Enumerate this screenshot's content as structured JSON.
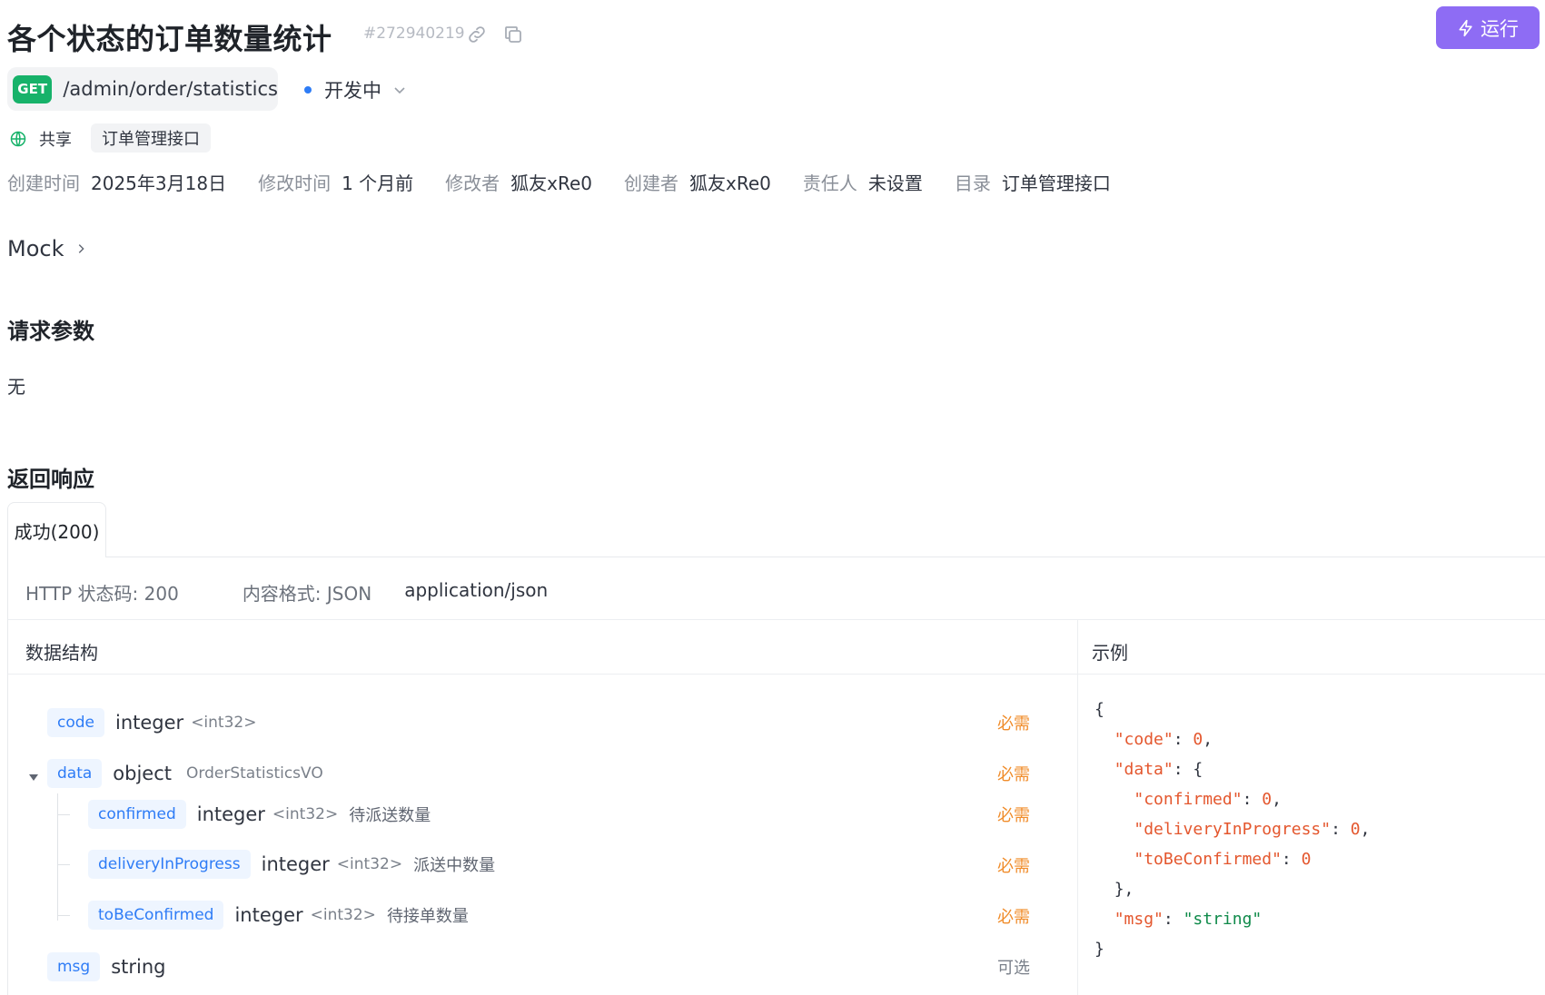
{
  "header": {
    "title": "各个状态的订单数量统计",
    "api_id": "#272940219",
    "run_label": "运行",
    "link_icon": "link-icon",
    "copy_icon": "copy-icon"
  },
  "endpoint": {
    "method": "GET",
    "path": "/admin/order/statistics",
    "status": "开发中",
    "status_color": "#2e7cf6",
    "method_color": "#17b26a"
  },
  "share": {
    "label": "共享",
    "tag": "订单管理接口"
  },
  "meta": [
    {
      "key": "创建时间",
      "value": "2025年3月18日"
    },
    {
      "key": "修改时间",
      "value": "1 个月前"
    },
    {
      "key": "修改者",
      "value": "狐友xRe0"
    },
    {
      "key": "创建者",
      "value": "狐友xRe0"
    },
    {
      "key": "责任人",
      "value": "未设置"
    },
    {
      "key": "目录",
      "value": "订单管理接口"
    }
  ],
  "mock_label": "Mock",
  "request": {
    "heading": "请求参数",
    "empty": "无"
  },
  "response": {
    "heading": "返回响应",
    "tab": "成功(200)",
    "http_status": "HTTP 状态码: 200",
    "content_type": "内容格式: JSON",
    "mime": "application/json",
    "schema_title": "数据结构",
    "example_title": "示例",
    "fields": [
      {
        "name": "code",
        "type": "integer",
        "format": "<int32>",
        "desc": "",
        "required": "必需"
      },
      {
        "name": "data",
        "type": "object",
        "format": "OrderStatisticsVO",
        "desc": "",
        "required": "必需"
      },
      {
        "name": "confirmed",
        "type": "integer",
        "format": "<int32>",
        "desc": "待派送数量",
        "required": "必需"
      },
      {
        "name": "deliveryInProgress",
        "type": "integer",
        "format": "<int32>",
        "desc": "派送中数量",
        "required": "必需"
      },
      {
        "name": "toBeConfirmed",
        "type": "integer",
        "format": "<int32>",
        "desc": "待接单数量",
        "required": "必需"
      },
      {
        "name": "msg",
        "type": "string",
        "format": "",
        "desc": "",
        "required": "可选"
      }
    ],
    "example": {
      "open": "{",
      "code_key": "\"code\"",
      "code_val": "0",
      "data_key": "\"data\"",
      "data_open": "{",
      "confirmed_key": "\"confirmed\"",
      "confirmed_val": "0",
      "dip_key": "\"deliveryInProgress\"",
      "dip_val": "0",
      "tbc_key": "\"toBeConfirmed\"",
      "tbc_val": "0",
      "data_close": "},",
      "msg_key": "\"msg\"",
      "msg_val": "\"string\"",
      "close": "}"
    }
  }
}
